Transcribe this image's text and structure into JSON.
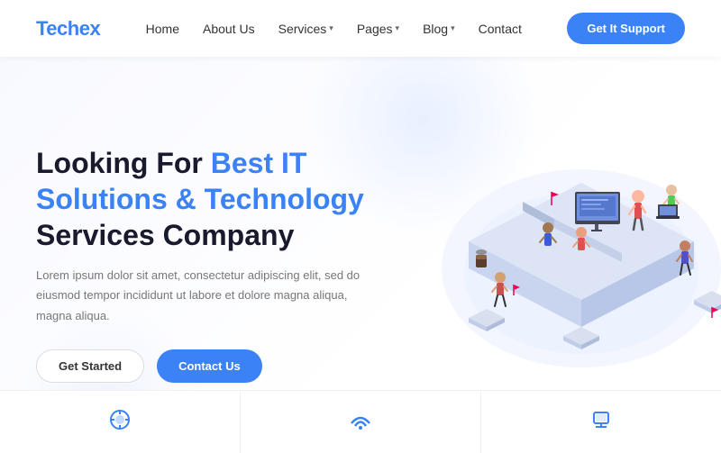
{
  "navbar": {
    "logo_text": "Tech",
    "logo_highlight": "ex",
    "links": [
      {
        "label": "Home",
        "has_arrow": false
      },
      {
        "label": "About Us",
        "has_arrow": false
      },
      {
        "label": "Services",
        "has_arrow": true
      },
      {
        "label": "Pages",
        "has_arrow": true
      },
      {
        "label": "Blog",
        "has_arrow": true
      },
      {
        "label": "Contact",
        "has_arrow": false
      }
    ],
    "cta_button": "Get It Support"
  },
  "hero": {
    "heading_line1": "Looking For ",
    "heading_highlight": "Best IT",
    "heading_line2": "Solutions & Technology",
    "heading_line3": "Services Company",
    "description": "Lorem ipsum dolor sit amet, consectetur adipiscing elit, sed do eiusmod tempor incididunt ut labore et dolore magna aliqua, magna aliqua.",
    "btn_get_started": "Get Started",
    "btn_contact": "Contact Us"
  },
  "bottom_cards": [
    {
      "icon": "⚙️",
      "label": ""
    },
    {
      "icon": "📡",
      "label": ""
    },
    {
      "icon": "🔧",
      "label": ""
    }
  ],
  "colors": {
    "blue": "#3b82f6",
    "dark": "#1a1a2e",
    "light_bg": "#f8f9ff"
  }
}
